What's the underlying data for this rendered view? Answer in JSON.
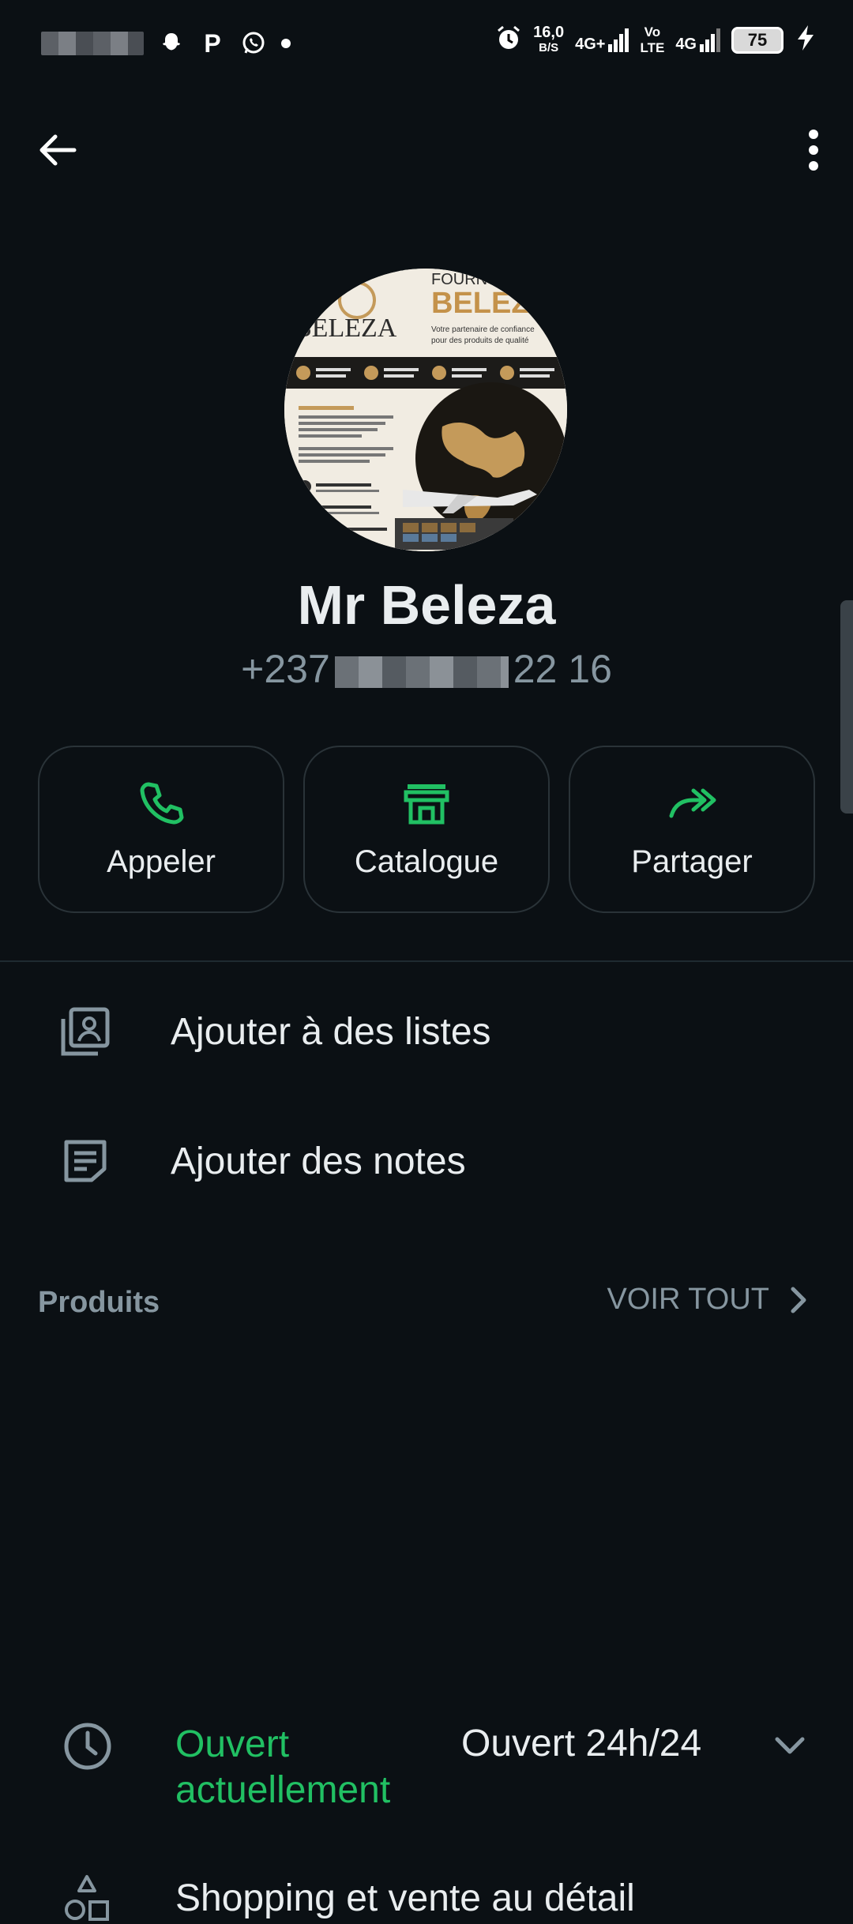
{
  "status_bar": {
    "net_speed_value": "16,0",
    "net_speed_unit": "B/S",
    "network_1": "4G+",
    "volte_top": "Vo",
    "volte_bottom": "LTE",
    "network_2": "4G",
    "battery_level": "75",
    "icons": [
      "snapchat-icon",
      "p-icon",
      "whatsapp-icon",
      "alarm-icon",
      "signal-icon",
      "charging-icon"
    ]
  },
  "header": {
    "back_icon": "arrow-left-icon",
    "menu_icon": "more-vertical-icon"
  },
  "profile": {
    "name": "Mr Beleza",
    "phone_prefix": "+237",
    "phone_suffix": "22 16",
    "avatar": {
      "brand": "BELEZA",
      "banner_title": "FOURN",
      "banner_brand": "BELEZ",
      "tagline_1": "Votre partenaire de confiance",
      "tagline_2": "pour des produits de qualité"
    }
  },
  "actions": [
    {
      "label": "Appeler",
      "icon": "phone-icon"
    },
    {
      "label": "Catalogue",
      "icon": "storefront-icon"
    },
    {
      "label": "Partager",
      "icon": "share-forward-icon"
    }
  ],
  "menu": {
    "add_to_lists": "Ajouter à des listes",
    "add_notes": "Ajouter des notes"
  },
  "products": {
    "title": "Produits",
    "see_all": "VOIR TOUT"
  },
  "business_info": {
    "hours_status": "Ouvert actuellement",
    "hours_value": "Ouvert 24h/24",
    "category": "Shopping et vente au détail"
  },
  "colors": {
    "background": "#0b1014",
    "accent_green": "#21c063",
    "text_primary": "#e9edef",
    "text_secondary": "#8696a0"
  }
}
